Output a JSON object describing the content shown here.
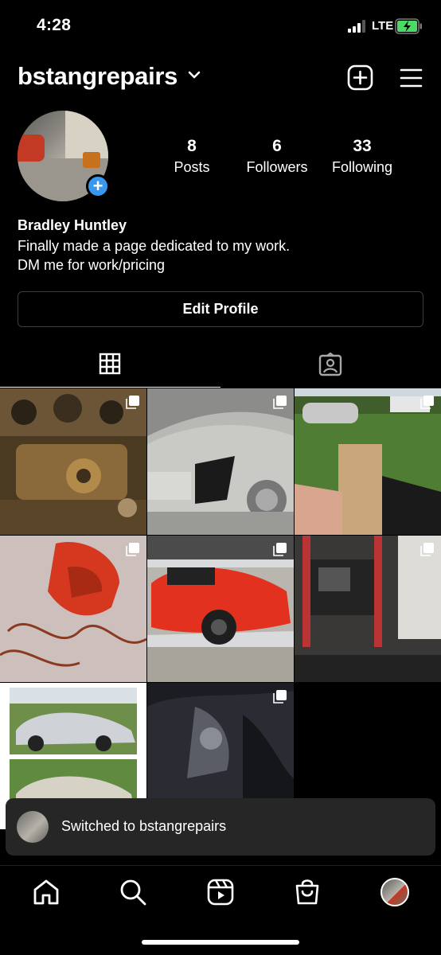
{
  "status_bar": {
    "time": "4:28",
    "network": "LTE"
  },
  "header": {
    "username": "bstangrepairs"
  },
  "profile": {
    "stats": [
      {
        "count": "8",
        "label": "Posts"
      },
      {
        "count": "6",
        "label": "Followers"
      },
      {
        "count": "33",
        "label": "Following"
      }
    ],
    "name": "Bradley Huntley",
    "bio": [
      "Finally made a page dedicated to my work.",
      "DM me for work/pricing"
    ],
    "edit_label": "Edit Profile"
  },
  "tabs": [
    {
      "icon": "grid-icon",
      "active": true
    },
    {
      "icon": "tagged-icon",
      "active": false
    }
  ],
  "posts": [
    {
      "subject": "engine-block",
      "multi": true
    },
    {
      "subject": "silver-cadillac-front",
      "multi": true
    },
    {
      "subject": "yard-wood-board",
      "multi": true
    },
    {
      "subject": "red-bumper-cover",
      "multi": true
    },
    {
      "subject": "red-mustang-wheel",
      "multi": true
    },
    {
      "subject": "garage-lift",
      "multi": true
    },
    {
      "subject": "silver-eclipse-pair",
      "multi": false
    },
    {
      "subject": "dark-headlight-damage",
      "multi": true
    }
  ],
  "toast": {
    "text": "Switched to bstangrepairs"
  },
  "bottom_nav": [
    "home-icon",
    "search-icon",
    "reels-icon",
    "shop-icon",
    "profile-avatar"
  ]
}
